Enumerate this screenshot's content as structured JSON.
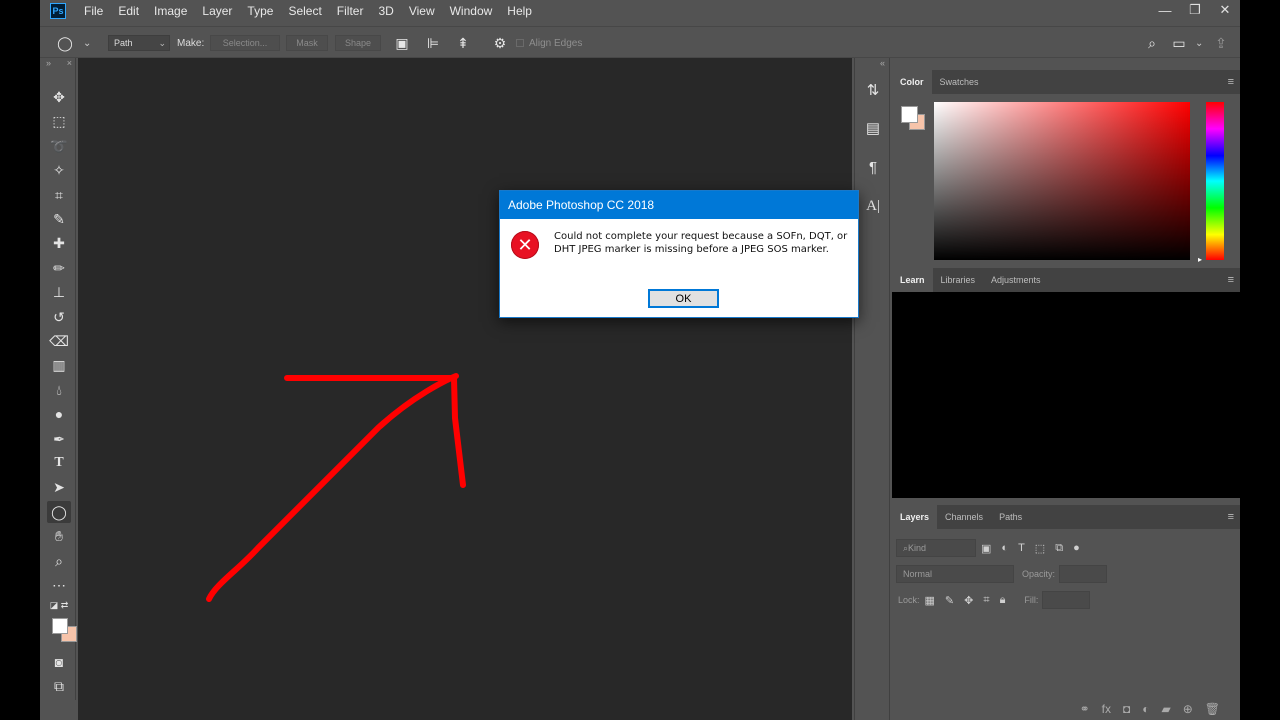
{
  "app": {
    "logo": "Ps",
    "title_icon": "photoshop-logo-icon"
  },
  "menu": [
    "File",
    "Edit",
    "Image",
    "Layer",
    "Type",
    "Select",
    "Filter",
    "3D",
    "View",
    "Window",
    "Help"
  ],
  "window_controls": {
    "minimize": "—",
    "restore": "❐",
    "close": "✕"
  },
  "options_bar": {
    "mode_value": "Path",
    "make_label": "Make:",
    "selection_label": "Selection...",
    "mask_label": "Mask",
    "shape_label": "Shape",
    "align_edges_label": "Align Edges"
  },
  "color_panel": {
    "tabs": [
      "Color",
      "Swatches"
    ],
    "foreground": "#ffffff",
    "background": "#f7c4aa"
  },
  "learn_panel": {
    "tabs": [
      "Learn",
      "Libraries",
      "Adjustments"
    ]
  },
  "layers_panel": {
    "tabs": [
      "Layers",
      "Channels",
      "Paths"
    ],
    "filter_value": "Kind",
    "blend_mode": "Normal",
    "opacity_label": "Opacity:",
    "lock_label": "Lock:",
    "fill_label": "Fill:"
  },
  "dialog": {
    "title": "Adobe Photoshop CC 2018",
    "message": "Could not complete your request because a SOFn, DQT, or DHT JPEG marker is missing before a JPEG SOS marker.",
    "ok_label": "OK",
    "icon": "error-icon"
  },
  "annotation": {
    "stroke_color": "#ff0000"
  }
}
